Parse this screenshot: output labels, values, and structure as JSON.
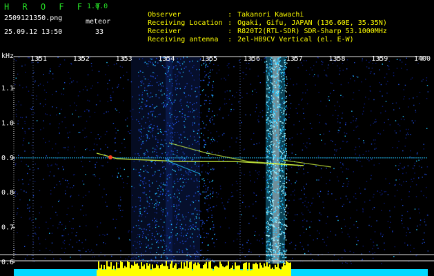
{
  "header": {
    "app_name": "H R O F F T",
    "version": "1.0.0",
    "filename": "2509121350.png",
    "datetime": "25.09.12 13:50",
    "meteor_label": "meteor",
    "meteor_count": "33"
  },
  "info": [
    {
      "key": "Observer",
      "sep": ":",
      "value": "Takanori Kawachi"
    },
    {
      "key": "Receiving Location",
      "sep": ":",
      "value": "Ogaki, Gifu, JAPAN (136.60E, 35.35N)"
    },
    {
      "key": "Receiver",
      "sep": ":",
      "value": "R820T2(RTL-SDR) SDR-Sharp 53.1000MHz"
    },
    {
      "key": "Receiving antenna",
      "sep": ":",
      "value": "2el-HB9CV Vertical (el. E-W)"
    }
  ],
  "spectrogram": {
    "y_unit": "kHz",
    "y_ticks": [
      "1.1",
      "1.0",
      "0.9",
      "0.8",
      "0.7",
      "0.6"
    ],
    "x_ticks": [
      "1351",
      "1352",
      "1353",
      "1354",
      "1355",
      "1356",
      "1357",
      "1358",
      "1359",
      "1400"
    ]
  },
  "colors": {
    "background": "#000000",
    "header_green": "#26e226",
    "header_white": "#ffffff",
    "noise_dark": "#0b1a7a",
    "noise_mid": "#1f4cd8",
    "noise_bright": "#24c6ff",
    "signal": "#ffffff",
    "echo_line": "#d8ff40",
    "meteor_head": "#ff4020",
    "amplitude_bars": "#ffff00",
    "amplitude_base": "#00d8ff",
    "axis_line": "#e8e8e8"
  }
}
